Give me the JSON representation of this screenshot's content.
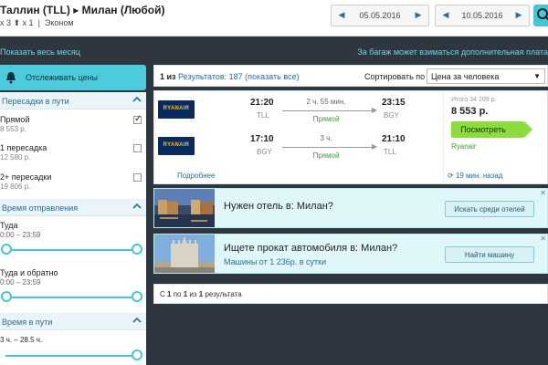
{
  "header": {
    "route": "Таллин (TLL) ▸ Милан (Любой)",
    "passengers": "x 3 ⬆ x 1",
    "cabin": "Эконом",
    "date_depart": "05.05.2016",
    "date_return": "10.05.2016"
  },
  "band": {
    "show_month": "Показать весь месяц",
    "baggage_note": "За багаж может взиматься дополнительная плата"
  },
  "sidebar": {
    "track_prices": "Отслеживать цены",
    "stops_title": "Пересадки в пути",
    "stops": [
      {
        "label": "Прямой",
        "price": "8 553 р.",
        "checked": true
      },
      {
        "label": "1 пересадка",
        "price": "12 580 р.",
        "checked": false
      },
      {
        "label": "2+ пересадки",
        "price": "19 806 р.",
        "checked": false
      }
    ],
    "departure_title": "Время отправления",
    "outbound_label": "Туда",
    "outbound_range": "0:00 – 23:59",
    "roundtrip_label": "Туда и обратно",
    "roundtrip_range": "0:00 – 23:59",
    "duration_title": "Время в пути",
    "duration_range": "3 ч. – 28.5 ч."
  },
  "results": {
    "count_prefix": "1 из",
    "count_link": "Результатов: 187 (показать все)",
    "sort_label": "Сортировать по",
    "sort_value": "Цена за человека"
  },
  "flight": {
    "airline": "RYANAIR",
    "legs": [
      {
        "dep_time": "21:20",
        "dep_code": "TLL",
        "duration": "2 ч. 55 мин.",
        "stops": "Прямой",
        "arr_time": "23:15",
        "arr_code": "BGY"
      },
      {
        "dep_time": "17:10",
        "dep_code": "BGY",
        "duration": "3 ч.",
        "stops": "Прямой",
        "arr_time": "21:10",
        "arr_code": "TLL"
      }
    ],
    "details": "Подробнее",
    "price_total": "Итого 34 209 р.",
    "price": "8 553 р.",
    "view_button": "Посмотреть",
    "provider": "Ryanair",
    "updated": "19 мин. назад"
  },
  "promos": [
    {
      "title": "Нужен отель в: Милан?",
      "subtitle": "",
      "button": "Искать среди отелей"
    },
    {
      "title": "Ищете прокат автомобиля в: Милан?",
      "subtitle": "Машины от 1 236р. в сутки",
      "button": "Найти машину"
    }
  ],
  "pager": {
    "p1": "С",
    "p2": "1",
    "p3": "по",
    "p4": "1",
    "p5": "из",
    "p6": "1",
    "p7": "результата"
  },
  "colors": {
    "accent": "#47c6d6",
    "link": "#2a6e9e",
    "band": "#2e3640",
    "green_button": "#8bdc3c"
  }
}
